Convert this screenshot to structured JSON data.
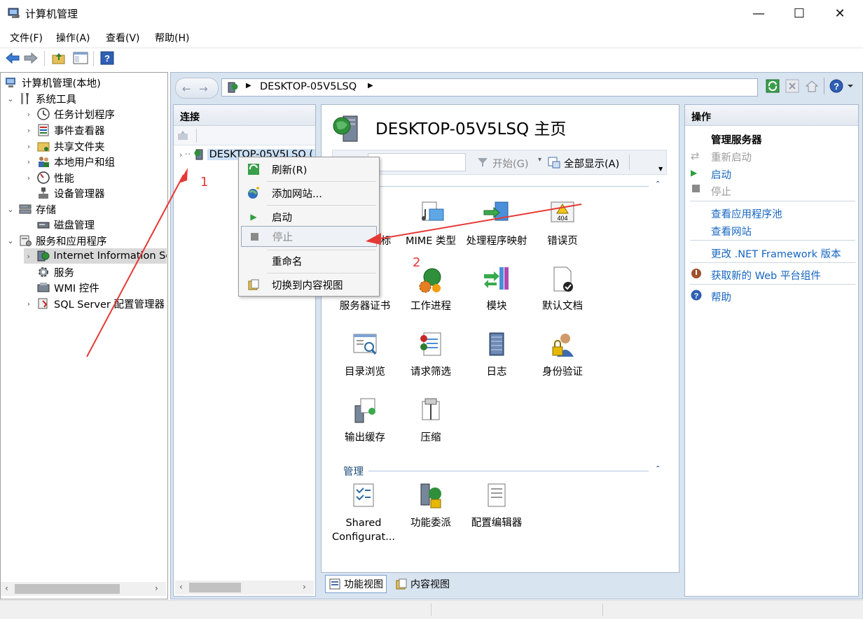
{
  "window": {
    "title": "计算机管理",
    "controls": {
      "minimize": "—",
      "maximize": "☐",
      "close": "✕"
    }
  },
  "menu": [
    "文件(F)",
    "操作(A)",
    "查看(V)",
    "帮助(H)"
  ],
  "tree": {
    "root": "计算机管理(本地)",
    "items": [
      {
        "label": "系统工具",
        "icon": "tools-icon"
      },
      {
        "label": "任务计划程序",
        "icon": "clock-icon"
      },
      {
        "label": "事件查看器",
        "icon": "event-viewer-icon"
      },
      {
        "label": "共享文件夹",
        "icon": "shared-folder-icon"
      },
      {
        "label": "本地用户和组",
        "icon": "users-icon"
      },
      {
        "label": "性能",
        "icon": "performance-icon"
      },
      {
        "label": "设备管理器",
        "icon": "device-manager-icon"
      },
      {
        "label": "存储",
        "icon": "storage-icon"
      },
      {
        "label": "磁盘管理",
        "icon": "disk-icon"
      },
      {
        "label": "服务和应用程序",
        "icon": "services-apps-icon"
      },
      {
        "label": "Internet Information Se",
        "icon": "iis-icon"
      },
      {
        "label": "服务",
        "icon": "gear-icon"
      },
      {
        "label": "WMI 控件",
        "icon": "wmi-icon"
      },
      {
        "label": "SQL Server 配置管理器",
        "icon": "sql-icon"
      }
    ]
  },
  "address": {
    "path": "DESKTOP-05V5LSQ"
  },
  "connections": {
    "title": "连接",
    "server_label": "DESKTOP-05V5LSQ ("
  },
  "context_menu": {
    "items": [
      {
        "label": "刷新(R)",
        "icon": "refresh-icon"
      },
      {
        "label": "添加网站...",
        "icon": "add-site-icon"
      },
      {
        "label": "启动",
        "icon": "start-icon"
      },
      {
        "label": "停止",
        "icon": "stop-icon",
        "disabled": true
      },
      {
        "label": "重命名",
        "icon": ""
      },
      {
        "label": "切换到内容视图",
        "icon": "content-view-icon"
      }
    ]
  },
  "center": {
    "title": "DESKTOP-05V5LSQ 主页",
    "filter": {
      "start": "开始(G)",
      "show_all": "全部显示(A)"
    },
    "features_row1": [
      "标",
      "MIME 类型",
      "处理程序映射",
      "错误页"
    ],
    "features_row2": [
      "服务器证书",
      "工作进程",
      "模块",
      "默认文档"
    ],
    "features_row3": [
      "目录浏览",
      "请求筛选",
      "日志",
      "身份验证"
    ],
    "features_row4": [
      "输出缓存",
      "压缩"
    ],
    "section_manage": "管理",
    "features_manage": [
      "Shared Configurat...",
      "功能委派",
      "配置编辑器"
    ]
  },
  "bottom_tabs": {
    "features_view": "功能视图",
    "content_view": "内容视图"
  },
  "actions": {
    "title": "操作",
    "manage_server": "管理服务器",
    "restart": "重新启动",
    "start": "启动",
    "stop": "停止",
    "view_app_pools": "查看应用程序池",
    "view_sites": "查看网站",
    "change_net": "更改 .NET Framework 版本",
    "get_web_components": "获取新的 Web 平台组件",
    "help": "帮助"
  },
  "annotations": {
    "one": "1",
    "two": "2"
  },
  "colors": {
    "accent_link": "#1565c0",
    "annotation_red": "#e53935",
    "iis_bg": "#d9e4f1"
  }
}
